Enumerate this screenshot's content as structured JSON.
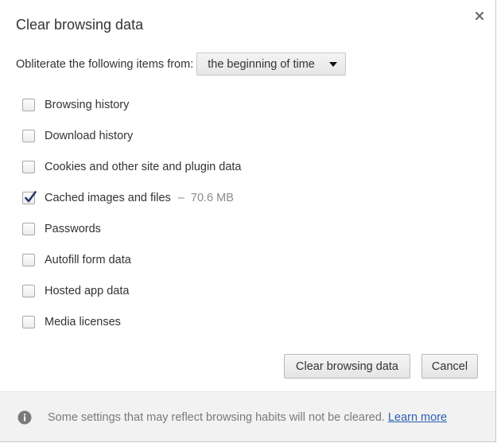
{
  "dialog": {
    "title": "Clear browsing data",
    "close_icon": "close-icon"
  },
  "obliterate": {
    "label": "Obliterate the following items from:",
    "selected_option": "the beginning of time"
  },
  "items": [
    {
      "label": "Browsing history",
      "checked": false
    },
    {
      "label": "Download history",
      "checked": false
    },
    {
      "label": "Cookies and other site and plugin data",
      "checked": false
    },
    {
      "label": "Cached images and files",
      "checked": true,
      "separator": "–",
      "size": "70.6 MB"
    },
    {
      "label": "Passwords",
      "checked": false
    },
    {
      "label": "Autofill form data",
      "checked": false
    },
    {
      "label": "Hosted app data",
      "checked": false
    },
    {
      "label": "Media licenses",
      "checked": false
    }
  ],
  "buttons": {
    "clear_label": "Clear browsing data",
    "cancel_label": "Cancel"
  },
  "footer": {
    "icon": "info-icon",
    "text": "Some settings that may reflect browsing habits will not be cleared.",
    "link_label": "Learn more"
  },
  "colors": {
    "link": "#2a5db0",
    "footer_bg": "#f2f2f2",
    "check_mark": "#2b3a67"
  }
}
